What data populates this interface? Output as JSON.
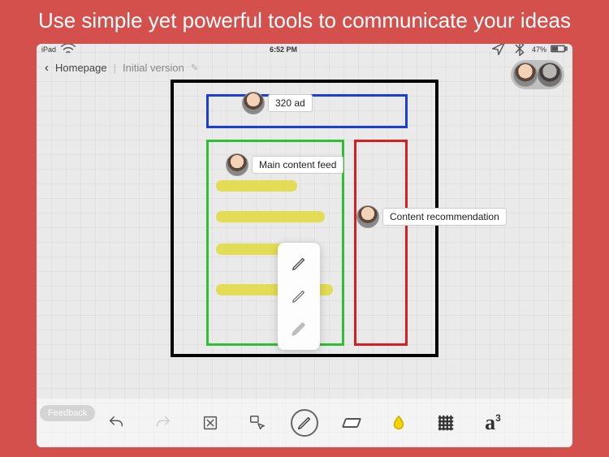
{
  "banner": "Use simple yet powerful tools to communicate your ideas",
  "status": {
    "carrier": "iPad",
    "wifi": true,
    "time": "6:52 PM",
    "battery": "47%"
  },
  "crumb": {
    "back": "Homepage",
    "version": "Initial version"
  },
  "callouts": {
    "ad": "320 ad",
    "main": "Main content feed",
    "rec": "Content recommendation"
  },
  "popup": {
    "pencil": "pencil",
    "pen": "pen",
    "marker": "marker"
  },
  "toolbar": {
    "undo": "Undo",
    "redo": "Redo",
    "clear": "Clear",
    "select": "Select",
    "draw": "Draw",
    "erase": "Erase",
    "color": "Color",
    "grid": "Grid",
    "text": "Text"
  },
  "feedback": "Feedback",
  "colors": {
    "blue": "#1a3fd6",
    "green": "#2fbf33",
    "red": "#d42020",
    "highlight": "#e1d93c"
  }
}
